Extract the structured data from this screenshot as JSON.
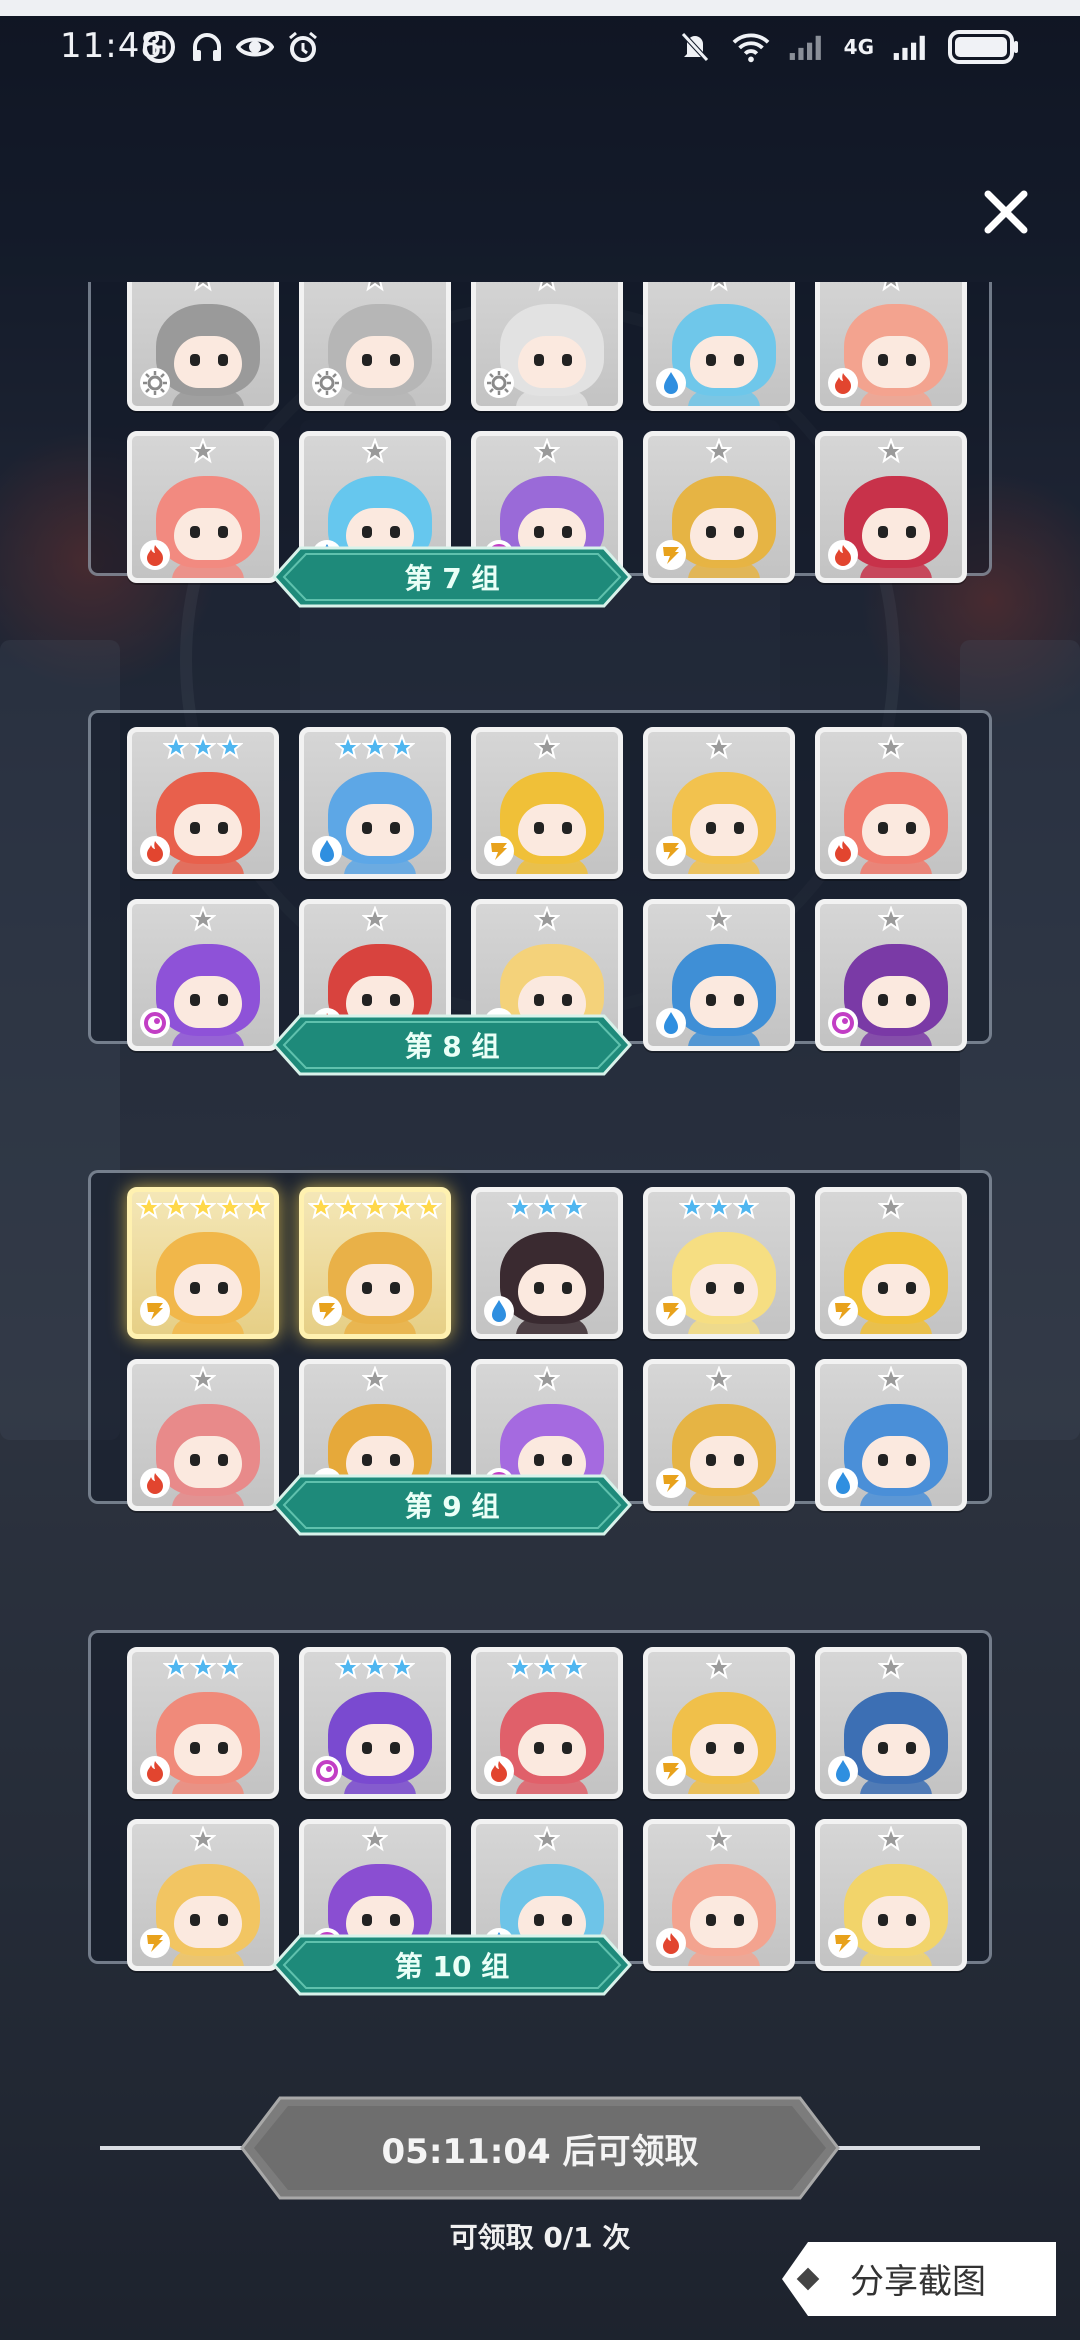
{
  "status_bar": {
    "time": "11:48",
    "network": "4G",
    "left_icons": [
      "notification-app-icon",
      "headphones-icon",
      "eye-icon",
      "alarm-icon"
    ],
    "right_icons": [
      "mute-icon",
      "wifi-icon",
      "signal-icon",
      "battery-icon"
    ]
  },
  "colors": {
    "label_teal": "#1e8a7a",
    "fire": "#e2452f",
    "water": "#2f8fe0",
    "lightning": "#e8a21c",
    "magic": "#c23ec5",
    "light": "#8a8a8a"
  },
  "groups": [
    {
      "label": "第 7 组",
      "rows": [
        [
          {
            "stars": 1,
            "element": "light",
            "hair": "#9a9a9a"
          },
          {
            "stars": 1,
            "element": "light",
            "hair": "#b6b6b6"
          },
          {
            "stars": 1,
            "element": "light",
            "hair": "#e2e2e2"
          },
          {
            "stars": 1,
            "element": "water",
            "hair": "#6fc7ea"
          },
          {
            "stars": 1,
            "element": "fire",
            "hair": "#f3a38f"
          }
        ],
        [
          {
            "stars": 1,
            "element": "fire",
            "hair": "#f28a80"
          },
          {
            "stars": 1,
            "element": "water",
            "hair": "#66c7ee"
          },
          {
            "stars": 1,
            "element": "magic",
            "hair": "#9a6ad8"
          },
          {
            "stars": 1,
            "element": "lightning",
            "hair": "#e6b444"
          },
          {
            "stars": 1,
            "element": "fire",
            "hair": "#c8324a"
          }
        ]
      ]
    },
    {
      "label": "第 8 组",
      "rows": [
        [
          {
            "stars": 3,
            "element": "fire",
            "hair": "#e8604c"
          },
          {
            "stars": 3,
            "element": "water",
            "hair": "#5da7e6"
          },
          {
            "stars": 1,
            "element": "lightning",
            "hair": "#f0c038"
          },
          {
            "stars": 1,
            "element": "lightning",
            "hair": "#f2c24e"
          },
          {
            "stars": 1,
            "element": "fire",
            "hair": "#f07a6c"
          }
        ],
        [
          {
            "stars": 1,
            "element": "magic",
            "hair": "#8e52d8"
          },
          {
            "stars": 1,
            "element": "fire",
            "hair": "#d8433e"
          },
          {
            "stars": 1,
            "element": "lightning",
            "hair": "#f4d27a"
          },
          {
            "stars": 1,
            "element": "water",
            "hair": "#3f8fd6"
          },
          {
            "stars": 1,
            "element": "magic",
            "hair": "#7a3aa6"
          }
        ]
      ]
    },
    {
      "label": "第 9 组",
      "rows": [
        [
          {
            "stars": 5,
            "element": "lightning",
            "hair": "#f1b74a",
            "gold": true
          },
          {
            "stars": 5,
            "element": "lightning",
            "hair": "#e9b148",
            "gold": true
          },
          {
            "stars": 3,
            "element": "water",
            "hair": "#3a2a30"
          },
          {
            "stars": 3,
            "element": "lightning",
            "hair": "#f6de82"
          },
          {
            "stars": 1,
            "element": "lightning",
            "hair": "#f0c038"
          }
        ],
        [
          {
            "stars": 1,
            "element": "fire",
            "hair": "#e88a8a"
          },
          {
            "stars": 1,
            "element": "lightning",
            "hair": "#e6a93a"
          },
          {
            "stars": 1,
            "element": "magic",
            "hair": "#a56ae0"
          },
          {
            "stars": 1,
            "element": "lightning",
            "hair": "#e6b444"
          },
          {
            "stars": 1,
            "element": "water",
            "hair": "#4a8fd8"
          }
        ]
      ]
    },
    {
      "label": "第 10 组",
      "rows": [
        [
          {
            "stars": 3,
            "element": "fire",
            "hair": "#f08a7a"
          },
          {
            "stars": 3,
            "element": "magic",
            "hair": "#7a4ad0"
          },
          {
            "stars": 3,
            "element": "fire",
            "hair": "#e0606a"
          },
          {
            "stars": 1,
            "element": "lightning",
            "hair": "#f0c04a"
          },
          {
            "stars": 1,
            "element": "water",
            "hair": "#3c6fb4"
          }
        ],
        [
          {
            "stars": 1,
            "element": "lightning",
            "hair": "#f2c562"
          },
          {
            "stars": 1,
            "element": "magic",
            "hair": "#8a4ed2"
          },
          {
            "stars": 1,
            "element": "water",
            "hair": "#6ec4e8"
          },
          {
            "stars": 1,
            "element": "fire",
            "hair": "#f3a38f"
          },
          {
            "stars": 1,
            "element": "lightning",
            "hair": "#f2d46a"
          }
        ]
      ]
    }
  ],
  "timer": {
    "label": "05:11:04 后可领取"
  },
  "claim": {
    "text": "可领取 0/1 次"
  },
  "share": {
    "label": "分享截图"
  }
}
